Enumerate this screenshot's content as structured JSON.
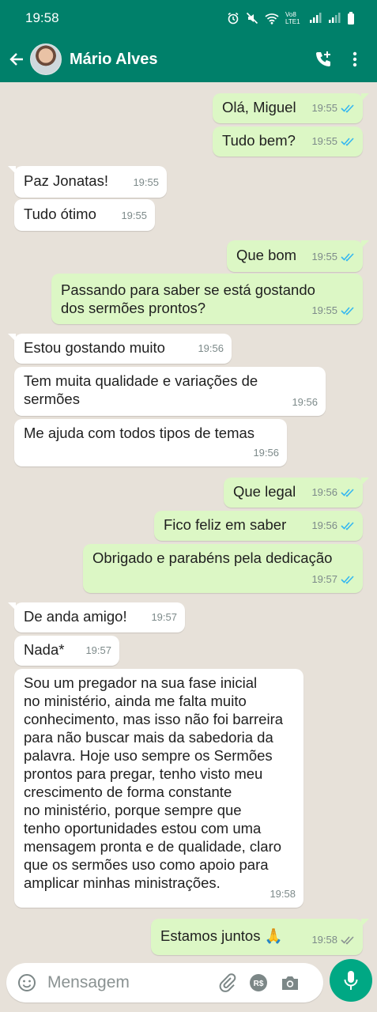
{
  "status_bar": {
    "time": "19:58",
    "network_label": "Vo8 LTE1"
  },
  "header": {
    "contact_name": "Mário Alves"
  },
  "colors": {
    "header": "#00806a",
    "outgoing_bubble": "#dcf7c5",
    "incoming_bubble": "#ffffff",
    "read_tick": "#34b7f1",
    "mic": "#00a884"
  },
  "messages": [
    {
      "text": "Olá, Miguel",
      "time": "19:55",
      "status": "read"
    },
    {
      "text": "Tudo bem?",
      "time": "19:55",
      "status": "read"
    },
    {
      "text": "Paz Jonatas!",
      "time": "19:55"
    },
    {
      "text": "Tudo ótimo",
      "time": "19:55"
    },
    {
      "text": "Que bom",
      "time": "19:55",
      "status": "read"
    },
    {
      "text": "Passando para saber se está gostando\ndos sermões prontos?",
      "time": "19:55",
      "status": "read"
    },
    {
      "text": "Estou gostando muito",
      "time": "19:56"
    },
    {
      "text": "Tem muita qualidade e variações de\nsermões",
      "time": "19:56"
    },
    {
      "text": "Me ajuda com todos tipos de temas",
      "time": "19:56"
    },
    {
      "text": "Que legal",
      "time": "19:56",
      "status": "read"
    },
    {
      "text": "Fico feliz em saber",
      "time": "19:56",
      "status": "read"
    },
    {
      "text": "Obrigado e parabéns pela dedicação",
      "time": "19:57",
      "status": "read"
    },
    {
      "text": "De anda amigo!",
      "time": "19:57"
    },
    {
      "text": "Nada*",
      "time": "19:57"
    },
    {
      "text": "Sou um pregador na sua fase inicial\nno ministério, ainda me falta muito\nconhecimento, mas isso não foi barreira\npara não buscar mais da sabedoria da\npalavra. Hoje uso sempre os Sermões\nprontos para pregar, tenho visto meu\ncrescimento de forma constante\nno ministério, porque sempre que\ntenho oportunidades estou com uma\nmensagem pronta e de qualidade, claro\nque os sermões uso como apoio para\namplicar minhas ministrações.",
      "time": "19:58"
    },
    {
      "text": "Estamos juntos 🙏",
      "time": "19:58",
      "status": "delivered"
    }
  ],
  "composer": {
    "placeholder": "Mensagem",
    "payment_icon_label": "R$"
  }
}
